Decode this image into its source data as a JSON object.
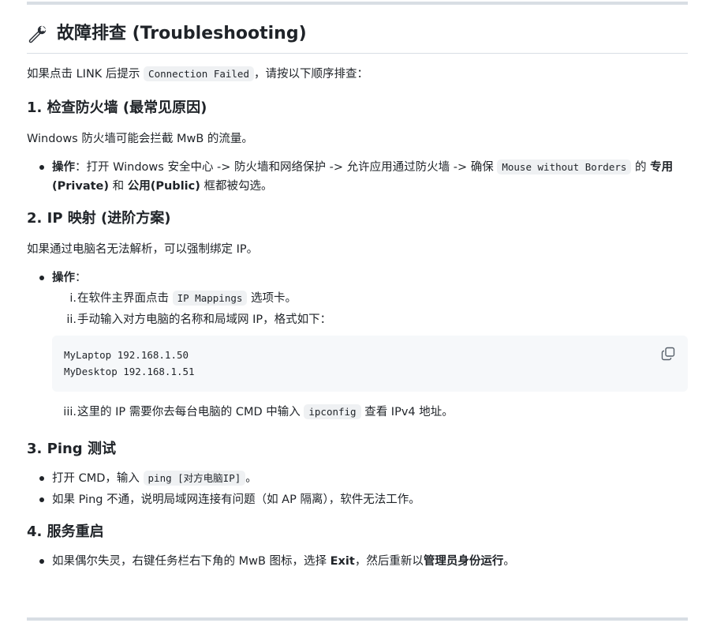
{
  "title": "故障排查 (Troubleshooting)",
  "intro": {
    "before": "如果点击 LINK 后提示",
    "code": "Connection Failed",
    "after": "，请按以下顺序排查："
  },
  "section1": {
    "heading": "1. 检查防火墙 (最常见原因)",
    "text": "Windows 防火墙可能会拦截 MwB 的流量。",
    "bullet": {
      "label": "操作",
      "colon": "：",
      "text1": "打开 Windows 安全中心 -> 防火墙和网络保护 -> 允许应用通过防火墙 -> 确保",
      "code": "Mouse without Borders",
      "text2": "的",
      "bold1": "专用(Private)",
      "text3": "和",
      "bold2": "公用(Public)",
      "text4": "框都被勾选。"
    }
  },
  "section2": {
    "heading": "2. IP 映射 (进阶方案)",
    "text": "如果通过电脑名无法解析，可以强制绑定 IP。",
    "bullet_label": "操作",
    "bullet_colon": "：",
    "steps": [
      {
        "num": "i.",
        "before": "在软件主界面点击",
        "code": "IP Mappings",
        "after": "选项卡。"
      },
      {
        "num": "ii.",
        "text": "手动输入对方电脑的名称和局域网 IP，格式如下："
      },
      {
        "num": "iii.",
        "before": "这里的 IP 需要你去每台电脑的 CMD 中输入",
        "code": "ipconfig",
        "after": "查看 IPv4 地址。"
      }
    ],
    "codeblock": {
      "line1": "MyLaptop 192.168.1.50",
      "line2": "MyDesktop 192.168.1.51",
      "copy_icon": "copy-icon"
    }
  },
  "section3": {
    "heading": "3. Ping 测试",
    "bullets": [
      {
        "before": "打开 CMD，输入",
        "code": "ping [对方电脑IP]",
        "after": "。"
      },
      {
        "text": "如果 Ping 不通，说明局域网连接有问题（如 AP 隔离），软件无法工作。"
      }
    ]
  },
  "section4": {
    "heading": "4. 服务重启",
    "bullet": {
      "text1": "如果偶尔失灵，右键任务栏右下角的 MwB 图标，选择",
      "bold1": "Exit",
      "text2": "，然后重新以",
      "bold2": "管理员身份运行",
      "text3": "。"
    }
  },
  "icons": {
    "title_icon": "wrench-icon"
  }
}
